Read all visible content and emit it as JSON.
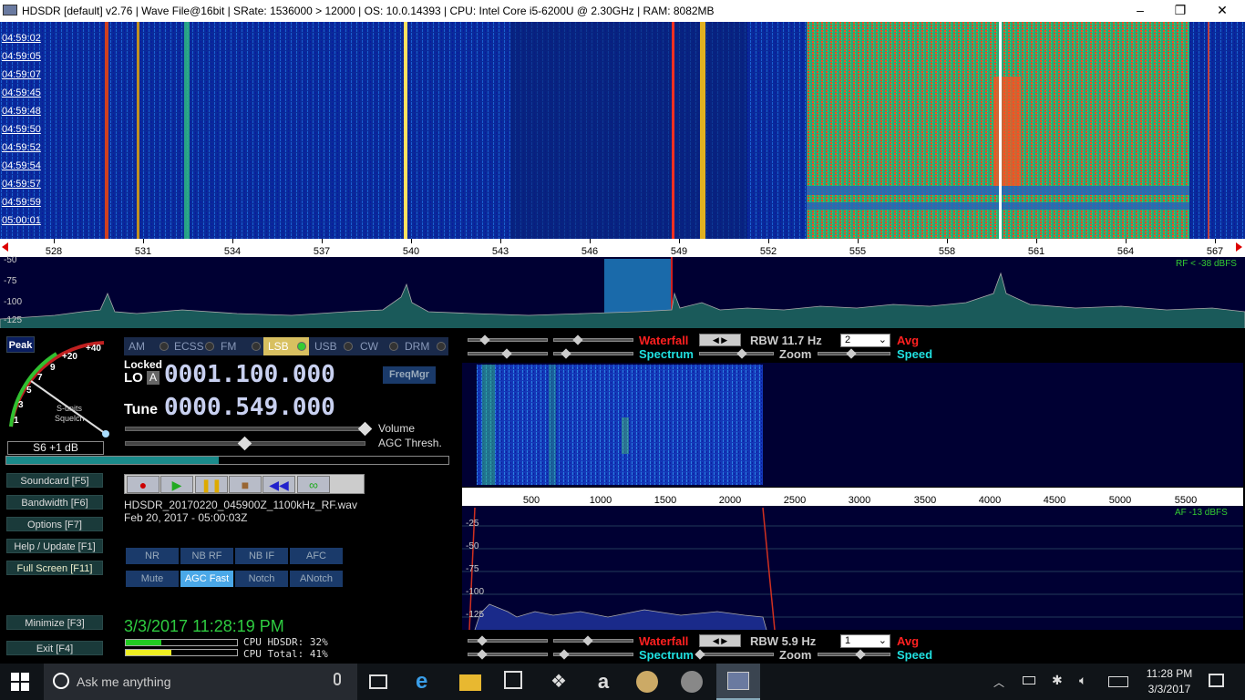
{
  "window": {
    "title": "HDSDR  [default]  v2.76   | Wave File@16bit  | SRate: 1536000 > 12000  | OS: 10.0.14393   | CPU: Intel Core i5-6200U @ 2.30GHz  | RAM: 8082MB",
    "min": "–",
    "max": "❐",
    "close": "✕"
  },
  "waterfall": {
    "time_labels": [
      "04:59:02",
      "04:59:05",
      "04:59:07",
      "04:59:45",
      "04:59:48",
      "04:59:50",
      "04:59:52",
      "04:59:54",
      "04:59:57",
      "04:59:59",
      "05:00:01"
    ]
  },
  "freq_axis": {
    "ticks": [
      "528",
      "531",
      "534",
      "537",
      "540",
      "543",
      "546",
      "549",
      "552",
      "555",
      "558",
      "561",
      "564",
      "567"
    ]
  },
  "spectrum": {
    "db_labels": [
      "-50",
      "-75",
      "-100",
      "-125"
    ],
    "rf_level": "RF < -38 dBFS"
  },
  "meter": {
    "peak": "Peak",
    "scale": [
      "+40",
      "+20",
      "9",
      "7",
      "5",
      "3",
      "1"
    ],
    "s_units": "S-units",
    "squelch": "Squelch",
    "reading": "S6 +1 dB"
  },
  "modes": [
    "AM",
    "ECSS",
    "FM",
    "LSB",
    "USB",
    "CW",
    "DRM"
  ],
  "active_mode": "LSB",
  "lo": {
    "locked": "Locked",
    "label": "LO",
    "a": "A",
    "freq": "0001.100.000"
  },
  "tune": {
    "label": "Tune",
    "freq": "0000.549.000"
  },
  "freqmgr": "FreqMgr",
  "sliders": {
    "volume": "Volume",
    "agc": "AGC Thresh."
  },
  "side_buttons": [
    "Soundcard  [F5]",
    "Bandwidth  [F6]",
    "Options    [F7]",
    "Help / Update  [F1]",
    "Full Screen  [F11]",
    "Minimize  [F3]",
    "Exit        [F4]"
  ],
  "file": {
    "name": "HDSDR_20170220_045900Z_1100kHz_RF.wav",
    "date": "Feb 20, 2017 - 05:00:03Z"
  },
  "dsp": {
    "row1": [
      "NR",
      "NB RF",
      "NB IF",
      "AFC"
    ],
    "row2": [
      "Mute",
      "AGC Fast",
      "Notch",
      "ANotch"
    ]
  },
  "clock": "3/3/2017 11:28:19 PM",
  "cpu": {
    "hdsdr": "CPU HDSDR: 32%",
    "total": "CPU Total: 41%",
    "hdsdr_pct": 32,
    "total_pct": 41
  },
  "top_panel": {
    "waterfall": "Waterfall",
    "spectrum": "Spectrum",
    "rbw": "RBW 11.7 Hz",
    "zoom": "Zoom",
    "avg_value": "2",
    "avg": "Avg",
    "speed": "Speed"
  },
  "bottom_panel": {
    "waterfall": "Waterfall",
    "spectrum": "Spectrum",
    "rbw": "RBW  5.9 Hz",
    "zoom": "Zoom",
    "avg_value": "1",
    "avg": "Avg",
    "speed": "Speed"
  },
  "af_axis": {
    "ticks": [
      "500",
      "1000",
      "1500",
      "2000",
      "2500",
      "3000",
      "3500",
      "4000",
      "4500",
      "5000",
      "5500"
    ]
  },
  "af_spectrum": {
    "db_labels": [
      "-25",
      "-50",
      "-75",
      "-100",
      "-125"
    ],
    "af_level": "AF -13 dBFS"
  },
  "taskbar": {
    "search": "Ask me anything",
    "time": "11:28 PM",
    "date": "3/3/2017"
  },
  "colors": {
    "accent_green": "#2ecc40",
    "waterfall_red": "#ff2020",
    "spectrum_cyan": "#20e0e0",
    "avg_red": "#ff2020"
  }
}
